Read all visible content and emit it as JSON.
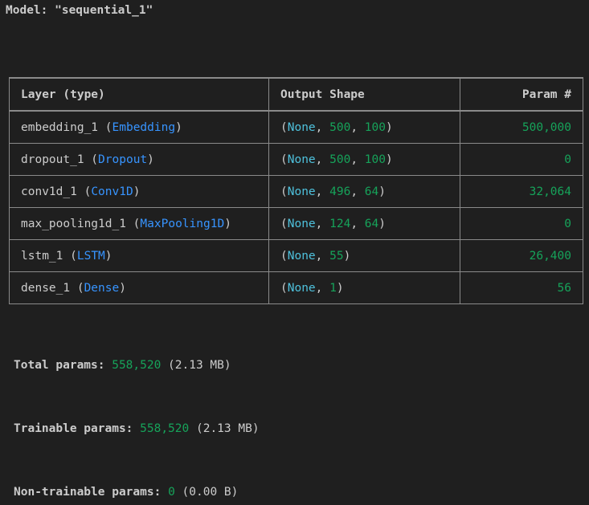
{
  "model": {
    "prefix": "Model: ",
    "name_quoted": "\"sequential_1\""
  },
  "table": {
    "headers": {
      "layer": "Layer (type)",
      "shape": "Output Shape",
      "params": "Param #"
    },
    "rows": [
      {
        "name": "embedding_1",
        "type": "Embedding",
        "shape_none": "None",
        "shape_dims": [
          "500",
          "100"
        ],
        "params": "500,000"
      },
      {
        "name": "dropout_1",
        "type": "Dropout",
        "shape_none": "None",
        "shape_dims": [
          "500",
          "100"
        ],
        "params": "0"
      },
      {
        "name": "conv1d_1",
        "type": "Conv1D",
        "shape_none": "None",
        "shape_dims": [
          "496",
          "64"
        ],
        "params": "32,064"
      },
      {
        "name": "max_pooling1d_1",
        "type": "MaxPooling1D",
        "shape_none": "None",
        "shape_dims": [
          "124",
          "64"
        ],
        "params": "0"
      },
      {
        "name": "lstm_1",
        "type": "LSTM",
        "shape_none": "None",
        "shape_dims": [
          "55"
        ],
        "params": "26,400"
      },
      {
        "name": "dense_1",
        "type": "Dense",
        "shape_none": "None",
        "shape_dims": [
          "1"
        ],
        "params": "56"
      }
    ]
  },
  "totals": {
    "total": {
      "label": "Total params: ",
      "value": "558,520",
      "size": " (2.13 MB)"
    },
    "trainable": {
      "label": "Trainable params: ",
      "value": "558,520",
      "size": " (2.13 MB)"
    },
    "non_trainable": {
      "label": "Non-trainable params: ",
      "value": "0",
      "size": " (0.00 B)"
    }
  },
  "colors": {
    "background": "#1f1f1f",
    "text": "#cccccc",
    "type_name": "#3794ff",
    "none_keyword": "#4ec1dc",
    "number": "#16a35a",
    "border": "#8a8a8a"
  }
}
